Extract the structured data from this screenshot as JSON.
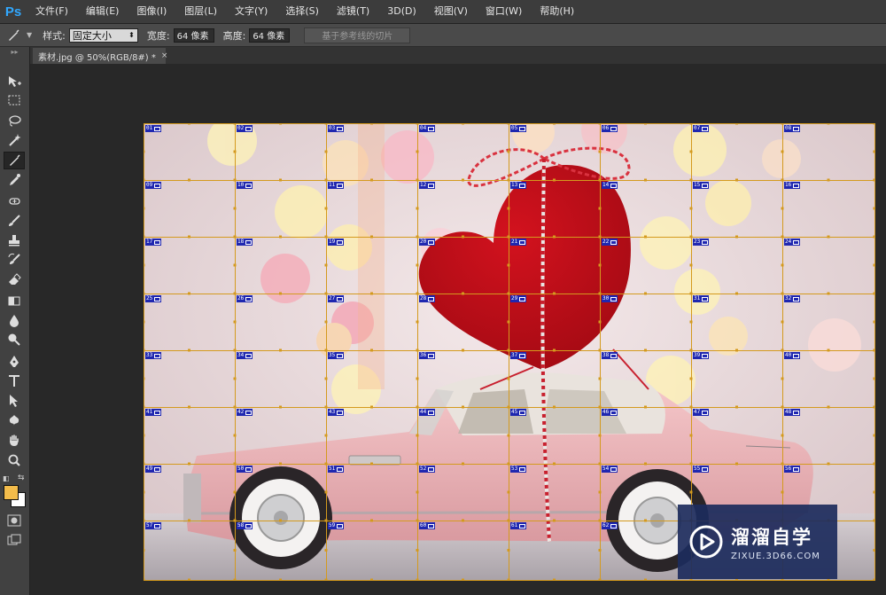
{
  "app": {
    "logo": "Ps"
  },
  "menu": [
    "文件(F)",
    "编辑(E)",
    "图像(I)",
    "图层(L)",
    "文字(Y)",
    "选择(S)",
    "滤镜(T)",
    "3D(D)",
    "视图(V)",
    "窗口(W)",
    "帮助(H)"
  ],
  "options": {
    "tool_icon": "slice-tool-icon",
    "style_label": "样式:",
    "style_value": "固定大小",
    "width_label": "宽度:",
    "width_value": "64 像素",
    "height_label": "高度:",
    "height_value": "64 像素",
    "guides_button": "基于参考线的切片"
  },
  "document": {
    "tab_title": "素材.jpg @ 50%(RGB/8#) *",
    "close": "×"
  },
  "tools": [
    "move-tool-icon",
    "marquee-tool-icon",
    "lasso-tool-icon",
    "magic-wand-tool-icon",
    "slice-tool-icon",
    "eyedropper-tool-icon",
    "spot-healing-tool-icon",
    "brush-tool-icon",
    "clone-stamp-tool-icon",
    "history-brush-tool-icon",
    "eraser-tool-icon",
    "gradient-tool-icon",
    "blur-tool-icon",
    "dodge-tool-icon",
    "pen-tool-icon",
    "type-tool-icon",
    "path-selection-tool-icon",
    "custom-shape-tool-icon",
    "hand-tool-icon",
    "zoom-tool-icon"
  ],
  "colors": {
    "foreground": "#f3bc4b",
    "background": "#ffffff",
    "slice_line": "#d49a1e",
    "slice_label": "#1f27b0"
  },
  "slices": [
    "01",
    "02",
    "03",
    "04",
    "05",
    "06",
    "07",
    "08",
    "09",
    "10",
    "11",
    "12",
    "13",
    "14",
    "15",
    "16",
    "17",
    "18",
    "19",
    "20",
    "21",
    "22",
    "23",
    "24",
    "25",
    "26",
    "27",
    "28",
    "29",
    "30",
    "31",
    "32",
    "33",
    "34",
    "35",
    "36",
    "37",
    "38",
    "39",
    "40",
    "41",
    "42",
    "43",
    "44",
    "45",
    "46",
    "47",
    "48",
    "49",
    "50",
    "51",
    "52",
    "53",
    "54",
    "55",
    "56",
    "57",
    "58",
    "59",
    "60",
    "61",
    "62"
  ],
  "watermark": {
    "name": "溜溜自学",
    "url": "ZIXUE.3D66.COM"
  }
}
